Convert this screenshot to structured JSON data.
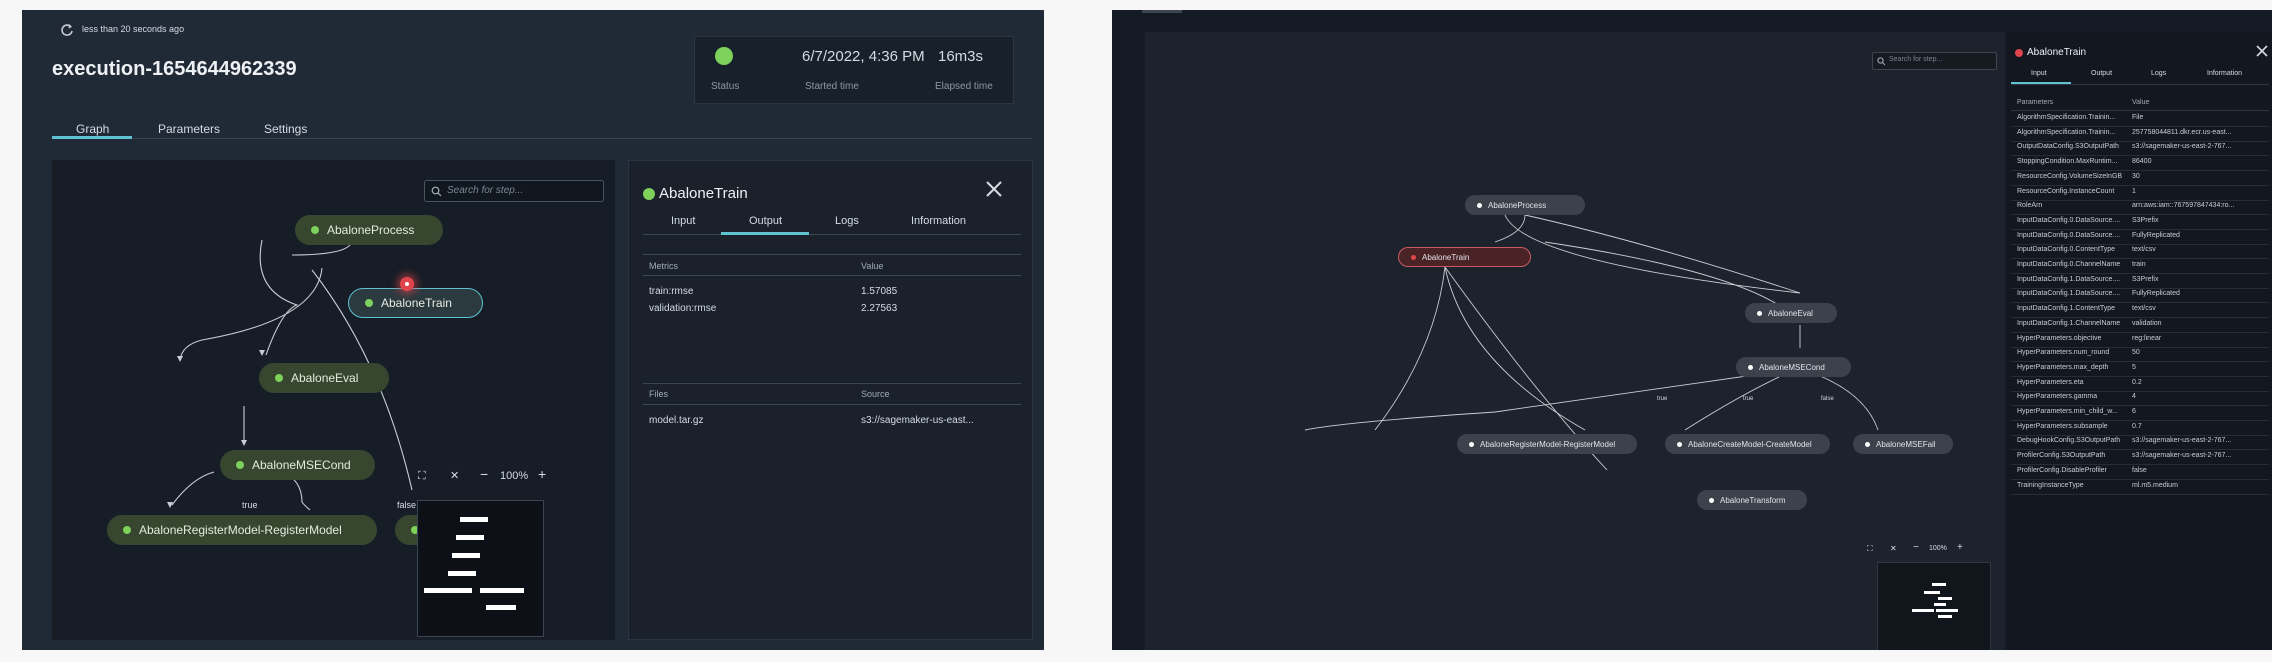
{
  "left": {
    "refresh_text": "less than 20 seconds ago",
    "execution_title": "execution-1654644962339",
    "summary": {
      "started_time": "6/7/2022, 4:36 PM",
      "elapsed_time": "16m3s",
      "status_label": "Status",
      "started_label": "Started time",
      "elapsed_label": "Elapsed time"
    },
    "tabs": [
      "Graph",
      "Parameters",
      "Settings"
    ],
    "search_placeholder": "Search for step...",
    "nodes": {
      "process": "AbaloneProcess",
      "train": "AbaloneTrain",
      "eval": "AbaloneEval",
      "msecond": "AbaloneMSECond",
      "register": "AbaloneRegisterModel-RegisterModel",
      "truncated": "Al"
    },
    "edge_labels": {
      "true": "true",
      "false": "false"
    },
    "zoom": "100%",
    "detail": {
      "title": "AbaloneTrain",
      "tabs": [
        "Input",
        "Output",
        "Logs",
        "Information"
      ],
      "metrics_header": "Metrics",
      "value_header": "Value",
      "metrics": [
        {
          "name": "train:rmse",
          "value": "1.57085"
        },
        {
          "name": "validation:rmse",
          "value": "2.27563"
        }
      ],
      "files_header": "Files",
      "source_header": "Source",
      "files": [
        {
          "name": "model.tar.gz",
          "source": "s3://sagemaker-us-east..."
        }
      ]
    }
  },
  "right": {
    "search_placeholder": "Search for step...",
    "nodes": {
      "process": "AbaloneProcess",
      "train": "AbaloneTrain",
      "eval": "AbaloneEval",
      "msecond": "AbaloneMSECond",
      "register": "AbaloneRegisterModel-RegisterModel",
      "create": "AbaloneCreateModel-CreateModel",
      "fail": "AbaloneMSEFail",
      "transform": "AbaloneTransform"
    },
    "edge_labels": {
      "true1": "true",
      "true2": "true",
      "false": "false"
    },
    "zoom": "100%",
    "detail": {
      "title": "AbaloneTrain",
      "tabs": [
        "Input",
        "Output",
        "Logs",
        "Information"
      ],
      "param_header": "Parameters",
      "value_header": "Value",
      "rows": [
        {
          "p": "AlgorithmSpecification.Trainin...",
          "v": "File"
        },
        {
          "p": "AlgorithmSpecification.Trainin...",
          "v": "257758044811.dkr.ecr.us-east..."
        },
        {
          "p": "OutputDataConfig.S3OutputPath",
          "v": "s3://sagemaker-us-east-2-767..."
        },
        {
          "p": "StoppingCondition.MaxRuntim...",
          "v": "86400"
        },
        {
          "p": "ResourceConfig.VolumeSizeInGB",
          "v": "30"
        },
        {
          "p": "ResourceConfig.InstanceCount",
          "v": "1"
        },
        {
          "p": "RoleArn",
          "v": "arn:aws:iam::767597847434:ro..."
        },
        {
          "p": "InputDataConfig.0.DataSource....",
          "v": "S3Prefix"
        },
        {
          "p": "InputDataConfig.0.DataSource....",
          "v": "FullyReplicated"
        },
        {
          "p": "InputDataConfig.0.ContentType",
          "v": "text/csv"
        },
        {
          "p": "InputDataConfig.0.ChannelName",
          "v": "train"
        },
        {
          "p": "InputDataConfig.1.DataSource....",
          "v": "S3Prefix"
        },
        {
          "p": "InputDataConfig.1.DataSource....",
          "v": "FullyReplicated"
        },
        {
          "p": "InputDataConfig.1.ContentType",
          "v": "text/csv"
        },
        {
          "p": "InputDataConfig.1.ChannelName",
          "v": "validation"
        },
        {
          "p": "HyperParameters.objective",
          "v": "reg:linear"
        },
        {
          "p": "HyperParameters.num_round",
          "v": "50"
        },
        {
          "p": "HyperParameters.max_depth",
          "v": "5"
        },
        {
          "p": "HyperParameters.eta",
          "v": "0.2"
        },
        {
          "p": "HyperParameters.gamma",
          "v": "4"
        },
        {
          "p": "HyperParameters.min_child_w...",
          "v": "6"
        },
        {
          "p": "HyperParameters.subsample",
          "v": "0.7"
        },
        {
          "p": "DebugHookConfig.S3OutputPath",
          "v": "s3://sagemaker-us-east-2-767..."
        },
        {
          "p": "ProfilerConfig.S3OutputPath",
          "v": "s3://sagemaker-us-east-2-767..."
        },
        {
          "p": "ProfilerConfig.DisableProfiler",
          "v": "false"
        },
        {
          "p": "TrainingInstanceType",
          "v": "ml.m5.medium"
        }
      ]
    }
  },
  "colors": {
    "success": "#7ed15a",
    "failed": "#e0454b",
    "accent": "#5ec2d1"
  }
}
